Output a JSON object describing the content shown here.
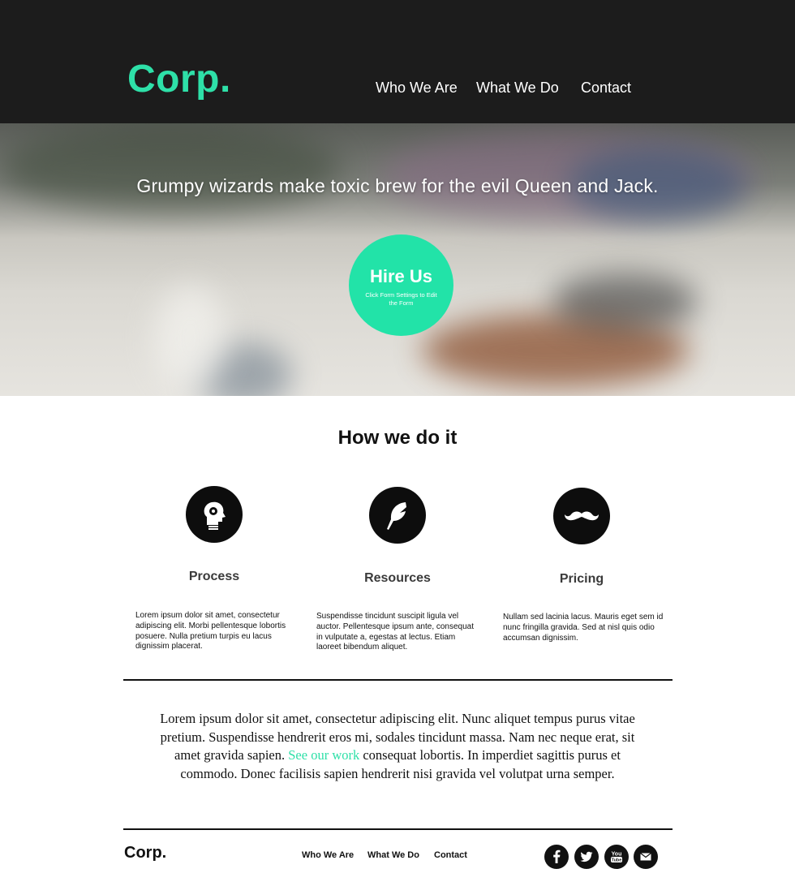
{
  "header": {
    "logo": "Corp.",
    "nav": [
      "Who We Are",
      "What We Do",
      "Contact"
    ]
  },
  "hero": {
    "headline": "Grumpy wizards make toxic brew for the evil Queen and Jack.",
    "cta_label": "Hire Us",
    "cta_sub": "Click Form Settings to Edit the Form"
  },
  "how": {
    "title": "How we do it",
    "features": [
      {
        "icon": "head-gear-icon",
        "name": "Process",
        "text": "Lorem ipsum dolor sit amet, consectetur adipiscing elit. Morbi pellentesque lobortis posuere. Nulla pretium turpis eu lacus dignissim placerat."
      },
      {
        "icon": "feather-icon",
        "name": "Resources",
        "text": "Suspendisse tincidunt suscipit ligula vel auctor. Pellentesque ipsum ante, consequat in vulputate a, egestas at lectus. Etiam laoreet bibendum aliquet."
      },
      {
        "icon": "mustache-icon",
        "name": "Pricing",
        "text": "Nullam sed lacinia lacus. Mauris eget sem id nunc fringilla gravida. Sed at nisl quis odio accumsan dignissim."
      }
    ]
  },
  "quote": {
    "before": "Lorem ipsum dolor sit amet, consectetur adipiscing elit. Nunc aliquet tempus purus vitae pretium. Suspendisse hendrerit eros mi, sodales tincidunt massa. Nam nec neque erat, sit amet gravida sapien. ",
    "link": "See our work",
    "after": " consequat lobortis. In imperdiet sagittis purus et commodo. Donec facilisis sapien hendrerit nisi gravida vel volutpat urna semper."
  },
  "footer": {
    "logo": "Corp.",
    "nav": [
      "Who We Are",
      "What We Do",
      "Contact"
    ],
    "social": [
      "facebook-icon",
      "twitter-icon",
      "youtube-icon",
      "email-icon"
    ],
    "youtube_label": "You\nTube"
  },
  "colors": {
    "accent": "#2ee0a8",
    "header_bg": "#1c1c1c",
    "cta_bg": "#22e3a8"
  }
}
